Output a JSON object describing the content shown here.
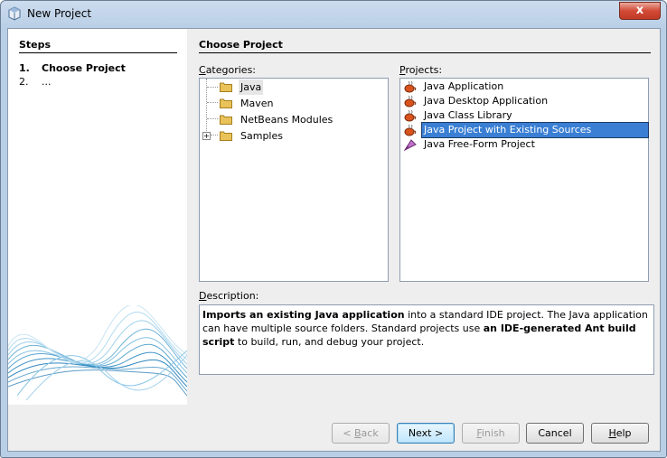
{
  "window": {
    "title": "New Project",
    "close_glyph": "x"
  },
  "steps": {
    "title": "Steps",
    "items": [
      {
        "num": "1.",
        "label": "Choose Project",
        "current": true
      },
      {
        "num": "2.",
        "label": "...",
        "current": false
      }
    ]
  },
  "main": {
    "title": "Choose Project",
    "categories_label_u": "C",
    "categories_label_rest": "ategories:",
    "projects_label_u": "P",
    "projects_label_rest": "rojects:",
    "description_label_u": "D",
    "description_label_rest": "escription:"
  },
  "categories": [
    {
      "label": "Java",
      "selected": true,
      "expandable": false
    },
    {
      "label": "Maven",
      "selected": false,
      "expandable": false
    },
    {
      "label": "NetBeans Modules",
      "selected": false,
      "expandable": false
    },
    {
      "label": "Samples",
      "selected": false,
      "expandable": true
    }
  ],
  "projects": [
    {
      "label": "Java Application",
      "icon": "java-cup-icon",
      "selected": false
    },
    {
      "label": "Java Desktop Application",
      "icon": "java-cup-icon",
      "selected": false
    },
    {
      "label": "Java Class Library",
      "icon": "java-cup-icon",
      "selected": false
    },
    {
      "label": "Java Project with Existing Sources",
      "icon": "java-cup-icon",
      "selected": true
    },
    {
      "label": "Java Free-Form Project",
      "icon": "freeform-project-icon",
      "selected": false
    }
  ],
  "description": {
    "bold1": "Imports an existing Java application",
    "text1": " into a standard IDE project. The Java application can have multiple source folders. Standard projects use ",
    "bold2": "an IDE-generated Ant build script",
    "text2": " to build, run, and debug your project."
  },
  "buttons": {
    "back_prefix": "< ",
    "back_u": "B",
    "back_rest": "ack",
    "next": "Next >",
    "finish_u": "F",
    "finish_rest": "inish",
    "cancel": "Cancel",
    "help_u": "H",
    "help_rest": "elp"
  },
  "colors": {
    "selection": "#3a7fd3",
    "title_bar": "#b9cfe6"
  }
}
